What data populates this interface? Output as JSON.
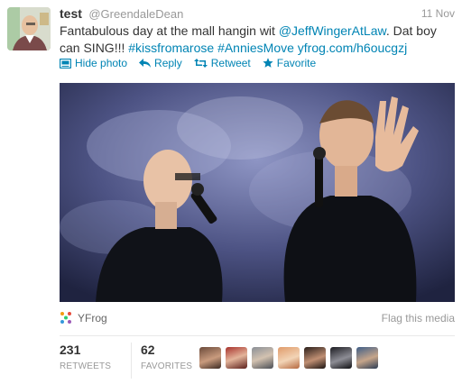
{
  "tweet": {
    "display_name": "test",
    "screen_name": "@GreendaleDean",
    "timestamp": "11 Nov",
    "text_1": "Fantabulous day at the mall hangin wit ",
    "mention": "@JeffWingerAtLaw",
    "text_2": ".  Dat boy can SING!!! ",
    "hashtag_1": "#kissfromarose",
    "hashtag_2": "#AnniesMove",
    "url": "yfrog.com/h6oucgzj"
  },
  "actions": {
    "hide_photo": "Hide photo",
    "reply": "Reply",
    "retweet": "Retweet",
    "favorite": "Favorite"
  },
  "media": {
    "provider": "YFrog",
    "flag_label": "Flag this media"
  },
  "stats": {
    "retweets_count": "231",
    "retweets_label": "RETWEETS",
    "favorites_count": "62",
    "favorites_label": "FAVORITES"
  },
  "colors": {
    "link": "#0084b4",
    "muted": "#999999",
    "text": "#333333"
  }
}
